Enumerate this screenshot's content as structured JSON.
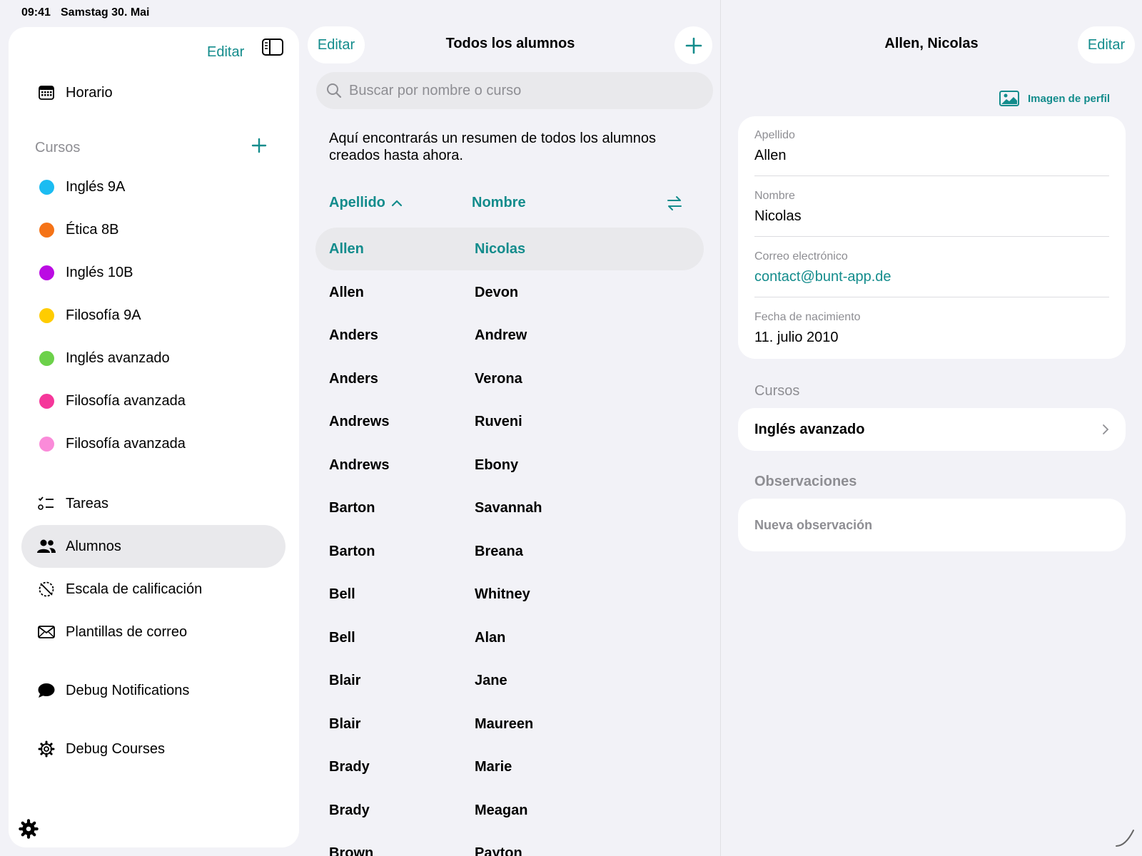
{
  "status_bar": {
    "time": "09:41",
    "date": "Samstag 30. Mai"
  },
  "sidebar": {
    "edit_label": "Editar",
    "schedule_label": "Horario",
    "courses_heading": "Cursos",
    "courses": [
      {
        "label": "Inglés 9A",
        "color": "#1bbcf2"
      },
      {
        "label": "Ética 8B",
        "color": "#f57317"
      },
      {
        "label": "Inglés 10B",
        "color": "#bb0be3"
      },
      {
        "label": "Filosofía 9A",
        "color": "#ffcc00"
      },
      {
        "label": "Inglés avanzado",
        "color": "#6cd14a"
      },
      {
        "label": "Filosofía avanzada",
        "color": "#f5379a"
      },
      {
        "label": "Filosofía avanzada",
        "color": "#fa8bd9"
      }
    ],
    "nav_items": [
      {
        "label": "Tareas",
        "icon": "checklist-icon"
      },
      {
        "label": "Alumnos",
        "icon": "people-icon",
        "selected": true
      },
      {
        "label": "Escala de calificación",
        "icon": "grading-scale-icon"
      },
      {
        "label": "Plantillas de correo",
        "icon": "envelope-icon"
      }
    ],
    "debug_items": [
      {
        "label": "Debug Notifications",
        "icon": "speech-bubble-icon"
      },
      {
        "label": "Debug Courses",
        "icon": "gear-icon"
      }
    ]
  },
  "students_list": {
    "edit_label": "Editar",
    "title": "Todos los alumnos",
    "search_placeholder": "Buscar por nombre o curso",
    "intro": "Aquí encontrarás un resumen de todos los alumnos creados hasta ahora.",
    "col_lastname": "Apellido",
    "col_firstname": "Nombre",
    "rows": [
      {
        "last": "Allen",
        "first": "Nicolas",
        "selected": true
      },
      {
        "last": "Allen",
        "first": "Devon"
      },
      {
        "last": "Anders",
        "first": "Andrew"
      },
      {
        "last": "Anders",
        "first": "Verona"
      },
      {
        "last": "Andrews",
        "first": "Ruveni"
      },
      {
        "last": "Andrews",
        "first": "Ebony"
      },
      {
        "last": "Barton",
        "first": "Savannah"
      },
      {
        "last": "Barton",
        "first": "Breana"
      },
      {
        "last": "Bell",
        "first": "Whitney"
      },
      {
        "last": "Bell",
        "first": "Alan"
      },
      {
        "last": "Blair",
        "first": "Jane"
      },
      {
        "last": "Blair",
        "first": "Maureen"
      },
      {
        "last": "Brady",
        "first": "Marie"
      },
      {
        "last": "Brady",
        "first": "Meagan"
      },
      {
        "last": "Brown",
        "first": "Payton"
      }
    ]
  },
  "detail": {
    "title": "Allen, Nicolas",
    "edit_label": "Editar",
    "profile_image_label": "Imagen de perfil",
    "fields": [
      {
        "label": "Apellido",
        "value": "Allen"
      },
      {
        "label": "Nombre",
        "value": "Nicolas"
      },
      {
        "label": "Correo electrónico",
        "value": "contact@bunt-app.de",
        "link": true
      },
      {
        "label": "Fecha de nacimiento",
        "value": "11. julio 2010"
      }
    ],
    "courses_heading": "Cursos",
    "course": "Inglés avanzado",
    "notes_heading": "Observaciones",
    "new_note": "Nueva observación"
  },
  "colors": {
    "accent": "#138c8c",
    "selected_bg": "#e9e9ec",
    "panel_bg": "#f2f2f7"
  }
}
